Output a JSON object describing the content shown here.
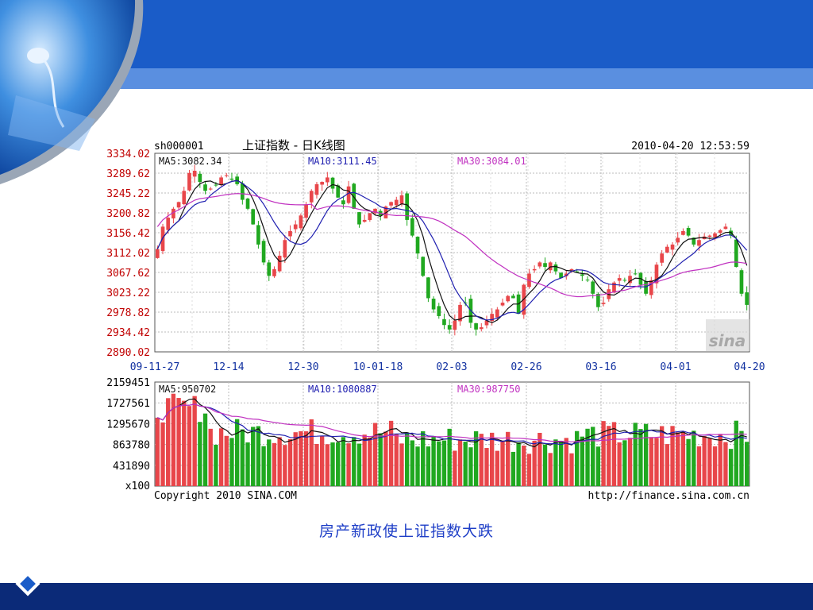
{
  "slide": {
    "caption": "房产新政使上证指数大跌",
    "colors": {
      "header_blue": "#1a5cc8",
      "footer_navy": "#0b2a78",
      "caption": "#1f3fc7"
    }
  },
  "chart_header": {
    "code": "sh000001",
    "name": "上证指数 - 日K线图",
    "timestamp": "2010-04-20 12:53:59"
  },
  "footer": {
    "copyright": "Copyright 2010 SINA.COM",
    "url": "http://finance.sina.com.cn"
  },
  "watermark": "sina",
  "chart_data": [
    {
      "type": "candlestick",
      "ylim": [
        2890.02,
        3334.02
      ],
      "y_ticks": [
        "3334.02",
        "3289.62",
        "3245.22",
        "3200.82",
        "3156.42",
        "3112.02",
        "3067.62",
        "3023.22",
        "2978.82",
        "2934.42",
        "2890.02"
      ],
      "x_ticks": [
        "09-11-27",
        "12-14",
        "12-30",
        "10-01-18",
        "02-03",
        "02-26",
        "03-16",
        "04-01",
        "04-20"
      ],
      "ma_labels": {
        "ma5": "MA5:3082.34",
        "ma10": "MA10:3111.45",
        "ma30": "MA30:3084.01"
      },
      "colors": {
        "up": "#e8464a",
        "down": "#20a820",
        "ma5": "#111111",
        "ma10": "#2020b0",
        "ma30": "#c030c0"
      },
      "grid": true,
      "closes": [
        3120,
        3170,
        3190,
        3210,
        3225,
        3250,
        3290,
        3295,
        3270,
        3250,
        3255,
        3262,
        3280,
        3285,
        3275,
        3265,
        3230,
        3210,
        3175,
        3130,
        3090,
        3060,
        3075,
        3105,
        3140,
        3160,
        3175,
        3195,
        3220,
        3250,
        3265,
        3270,
        3280,
        3255,
        3235,
        3220,
        3260,
        3210,
        3175,
        3185,
        3200,
        3210,
        3195,
        3215,
        3225,
        3230,
        3240,
        3185,
        3150,
        3110,
        3060,
        3010,
        2985,
        2970,
        2950,
        2940,
        2960,
        2995,
        3000,
        2955,
        2940,
        2945,
        2960,
        2975,
        2985,
        3000,
        3015,
        3010,
        2975,
        3040,
        3065,
        3075,
        3090,
        3080,
        3090,
        3070,
        3055,
        3065,
        3075,
        3070,
        3060,
        3050,
        3020,
        2990,
        3000,
        3030,
        3045,
        3055,
        3050,
        3060,
        3065,
        3040,
        3020,
        3050,
        3085,
        3110,
        3125,
        3130,
        3145,
        3160,
        3150,
        3130,
        3140,
        3148,
        3150,
        3155,
        3162,
        3170,
        3150,
        3080,
        3020,
        2995
      ]
    },
    {
      "type": "bar",
      "ylim": [
        0,
        2159451
      ],
      "y_ticks": [
        "2159451",
        "1727561",
        "1295670",
        "863780",
        "431890"
      ],
      "y_unit": "x100",
      "ma_labels": {
        "ma5": "MA5:950702",
        "ma10": "MA10:1080887",
        "ma30": "MA30:987750"
      },
      "grid": true
    }
  ]
}
